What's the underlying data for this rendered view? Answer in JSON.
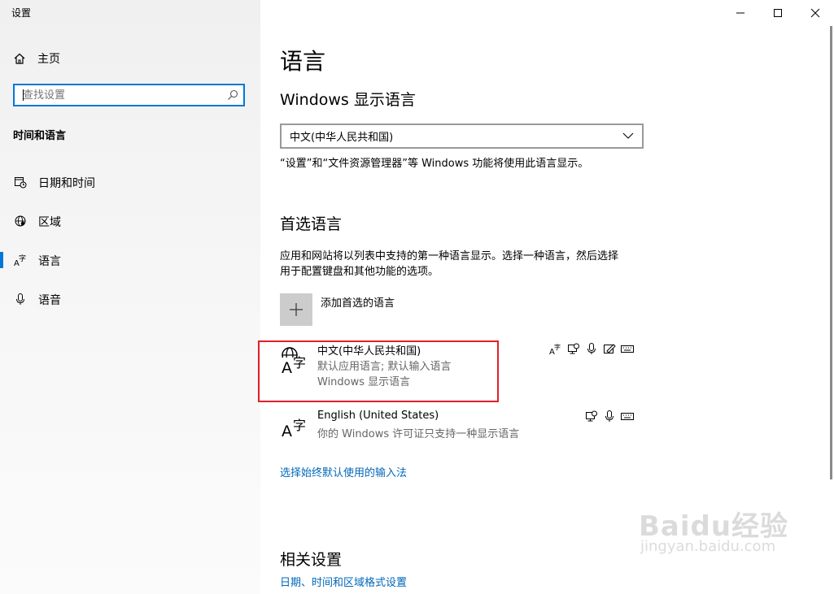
{
  "window": {
    "title": "设置"
  },
  "sidebar": {
    "home_label": "主页",
    "search_placeholder": "查找设置",
    "section_heading": "时间和语言",
    "items": [
      {
        "label": "日期和时间",
        "icon": "calendar-clock-icon",
        "active": false
      },
      {
        "label": "区域",
        "icon": "globe-region-icon",
        "active": false
      },
      {
        "label": "语言",
        "icon": "language-icon",
        "active": true
      },
      {
        "label": "语音",
        "icon": "microphone-icon",
        "active": false
      }
    ]
  },
  "main": {
    "title": "语言",
    "display_language": {
      "heading": "Windows 显示语言",
      "selected": "中文(中华人民共和国)",
      "description": "“设置”和“文件资源管理器”等 Windows 功能将使用此语言显示。"
    },
    "preferred_languages": {
      "heading": "首选语言",
      "description_line1": "应用和网站将以列表中支持的第一种语言显示。选择一种语言，然后选择",
      "description_line2": "用于配置键盘和其他功能的选项。",
      "add_label": "添加首选的语言",
      "languages": [
        {
          "name": "中文(中华人民共和国)",
          "line2": "默认应用语言; 默认输入语言",
          "line3": "Windows 显示语言",
          "features": [
            "display-language-icon",
            "speech-icon",
            "microphone-icon",
            "handwriting-icon",
            "keyboard-icon"
          ]
        },
        {
          "name": "English (United States)",
          "line2": "你的 Windows 许可证只支持一种显示语言",
          "features": [
            "speech-icon",
            "microphone-icon",
            "keyboard-icon"
          ]
        }
      ],
      "input_method_link": "选择始终默认使用的输入法"
    },
    "related": {
      "heading": "相关设置",
      "link": "日期、时间和区域格式设置"
    }
  },
  "watermark": {
    "brand": "Baidu经验",
    "url": "jingyan.baidu.com"
  },
  "colors": {
    "accent": "#0078d7",
    "link": "#0067b8",
    "highlight": "#e0202a"
  }
}
